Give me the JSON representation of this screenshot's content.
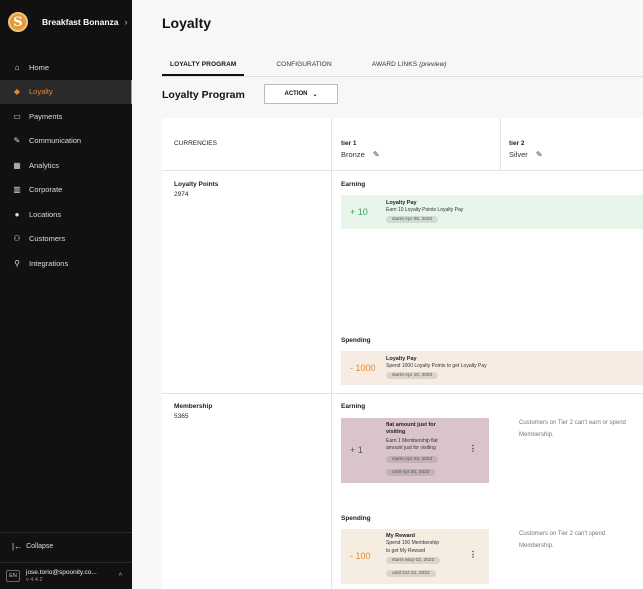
{
  "brand": {
    "logo_letter": "S",
    "name": "Breakfast Bonanza",
    "chevron": "›"
  },
  "sidebar": {
    "items": [
      {
        "label": "Home",
        "icon": "home-icon",
        "glyph": "⌂"
      },
      {
        "label": "Loyalty",
        "icon": "loyalty-tag-icon",
        "glyph": "◆",
        "active": true
      },
      {
        "label": "Payments",
        "icon": "payments-icon",
        "glyph": "▭"
      },
      {
        "label": "Communication",
        "icon": "communication-icon",
        "glyph": "✎"
      },
      {
        "label": "Analytics",
        "icon": "analytics-icon",
        "glyph": "▦"
      },
      {
        "label": "Corporate",
        "icon": "corporate-icon",
        "glyph": "▥"
      },
      {
        "label": "Locations",
        "icon": "location-pin-icon",
        "glyph": "●"
      },
      {
        "label": "Customers",
        "icon": "customers-icon",
        "glyph": "⚇"
      },
      {
        "label": "Integrations",
        "icon": "integrations-icon",
        "glyph": "⚲"
      }
    ],
    "collapse_label": "Collapse",
    "collapse_glyph": "|←",
    "lang": "EN",
    "user_email": "jose.torio@spoonity.co...",
    "version": "v 4.4.2",
    "user_chevron": "^"
  },
  "page": {
    "title": "Loyalty",
    "tabs": [
      {
        "label": "LOYALTY PROGRAM",
        "active": true
      },
      {
        "label": "CONFIGURATION"
      },
      {
        "label": "AWARD LINKS",
        "suffix": "(preview)"
      }
    ],
    "section_title": "Loyalty Program",
    "action_label": "ACTION",
    "action_chevron": "⌄"
  },
  "table": {
    "currencies_header": "CURRENCIES",
    "tiers": [
      {
        "label": "tier 1",
        "name": "Bronze"
      },
      {
        "label": "tier 2",
        "name": "Silver"
      }
    ],
    "pencil_glyph": "✎",
    "currencies": [
      {
        "name": "Loyalty Points",
        "value": "2974",
        "earning_label": "Earning",
        "earn_rule": {
          "amount": "+ 10",
          "title": "Loyalty Pay",
          "desc": "Earn 10 Loyalty Points Loyalty Pay",
          "pill": "starts Apr 08, 2020"
        },
        "spending_label": "Spending",
        "spend_rule": {
          "amount": "- 1000",
          "title": "Loyalty Pay",
          "desc": "Spend 1000 Loyalty Points to get Loyalty Pay",
          "pill": "starts Apr 10, 2020"
        }
      },
      {
        "name": "Membership",
        "value": "5365",
        "earning_label": "Earning",
        "earn_rule": {
          "amount": "+ 1",
          "title": "flat amount just for visiting",
          "desc_lines": [
            "Earn 1 Membership flat",
            "amount just for visiting"
          ],
          "pill_start": "starts Apr 03, 2023",
          "pill_end": "until Apr 30, 2023"
        },
        "earn_note": [
          "Customers on Tier 2 can't earn or spend",
          "Membership."
        ],
        "spending_label": "Spending",
        "spend_rule": {
          "amount": "- 100",
          "title": "My Reward",
          "desc_lines": [
            "Spend 100 Membership",
            "to get My Reward"
          ],
          "pill_start": "starts May 02, 2022",
          "pill_end": "until Oct 31, 2022"
        },
        "spend_note": [
          "Customers on Tier 2 can't spend",
          "Membership."
        ]
      }
    ],
    "kebab_glyph": "⋮"
  }
}
